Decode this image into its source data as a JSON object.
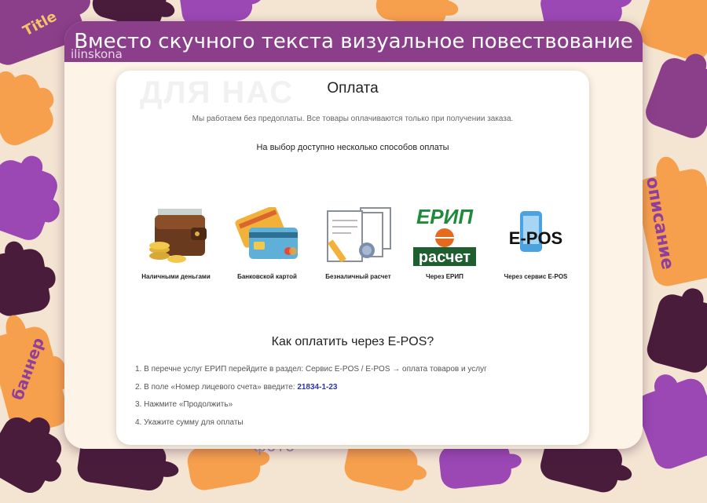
{
  "tags": {
    "title": "Title",
    "description": "описание",
    "banner": "баннер",
    "photo": "фото"
  },
  "banner": {
    "headline": "Вместо скучного текста визуальное повествование",
    "author": "ilinskona"
  },
  "card": {
    "ghost_text": "ДЛЯ НАС",
    "title": "Оплата",
    "intro": "Мы работаем без предоплаты. Все товары оплачиваются только при получении заказа.",
    "choice": "На выбор доступно несколько способов оплаты",
    "methods": [
      {
        "label": "Наличными деньгами",
        "icon": "wallet-icon"
      },
      {
        "label": "Банковской картой",
        "icon": "bank-card-icon"
      },
      {
        "label": "Безналичный расчет",
        "icon": "documents-icon"
      },
      {
        "label": "Через ЕРИП",
        "icon": "erip-logo"
      },
      {
        "label": "Через сервис E-POS",
        "icon": "epos-logo"
      }
    ],
    "erip_logo": {
      "top": "ЕРИП",
      "bottom": "расчет"
    },
    "epos_logo": "E-POS",
    "howto_title": "Как оплатить через E-POS?",
    "steps": [
      {
        "n": "1.",
        "text": "В перечне услуг ЕРИП перейдите в раздел: Сервис E-POS / E-POS → оплата товаров и услуг",
        "code": ""
      },
      {
        "n": "2.",
        "text": "В поле «Номер лицевого счета» введите: ",
        "code": "21834-1-23"
      },
      {
        "n": "3.",
        "text": "Нажмите «Продолжить»",
        "code": ""
      },
      {
        "n": "4.",
        "text": "Укажите сумму для оплаты",
        "code": ""
      }
    ]
  },
  "colors": {
    "purple": "#8b3f8a",
    "orange": "#f6a04d",
    "dark_purple": "#4a1c3c",
    "violet": "#9b48b5",
    "code_blue": "#2a35b5"
  }
}
